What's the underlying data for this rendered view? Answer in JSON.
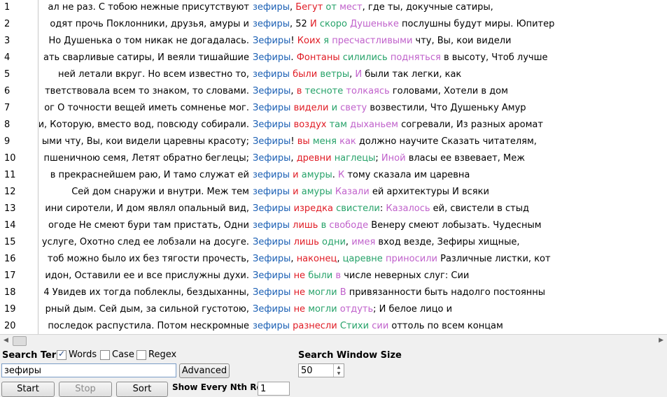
{
  "rows": [
    {
      "num": "1",
      "left": "ал не раз. С тобою нежные присутствуют",
      "right": [
        [
          "зефиры",
          "b"
        ],
        [
          ", ",
          "k"
        ],
        [
          "Бегут",
          "r"
        ],
        [
          " ",
          "k"
        ],
        [
          "от",
          "g"
        ],
        [
          " ",
          "k"
        ],
        [
          "мест",
          "m"
        ],
        [
          ", где ты, докучные сатиры,",
          "k"
        ]
      ]
    },
    {
      "num": "2",
      "left": "одят прочь Поклонники, друзья, амуры и",
      "right": [
        [
          "зефиры",
          "b"
        ],
        [
          ",  52 ",
          "k"
        ],
        [
          "И",
          "r"
        ],
        [
          " ",
          "k"
        ],
        [
          "скоро",
          "g"
        ],
        [
          " ",
          "k"
        ],
        [
          "Душеньке",
          "m"
        ],
        [
          " послушны будут миры. Юпитер",
          "k"
        ]
      ]
    },
    {
      "num": "3",
      "left": "Но Душенька о том никак не догадалась.",
      "right": [
        [
          "Зефиры",
          "b"
        ],
        [
          "! ",
          "k"
        ],
        [
          "Коих",
          "r"
        ],
        [
          " ",
          "k"
        ],
        [
          "я",
          "g"
        ],
        [
          " ",
          "k"
        ],
        [
          "пресчастливыми",
          "m"
        ],
        [
          " чту, Вы, кои видели",
          "k"
        ]
      ]
    },
    {
      "num": "4",
      "left": "ать сварливые сатиры, И веяли тишайшие",
      "right": [
        [
          "Зефиры",
          "b"
        ],
        [
          ". ",
          "k"
        ],
        [
          "Фонтаны",
          "r"
        ],
        [
          " ",
          "k"
        ],
        [
          "силились",
          "g"
        ],
        [
          " ",
          "k"
        ],
        [
          "подняться",
          "m"
        ],
        [
          " в высоту, Чтоб лучше",
          "k"
        ]
      ]
    },
    {
      "num": "5",
      "left": "ней летали вкруг. Но всем известно то,",
      "right": [
        [
          "зефиры",
          "b"
        ],
        [
          " ",
          "k"
        ],
        [
          "были",
          "r"
        ],
        [
          " ",
          "k"
        ],
        [
          "ветры",
          "g"
        ],
        [
          ", ",
          "k"
        ],
        [
          "И",
          "m"
        ],
        [
          " были так легки, как",
          "k"
        ]
      ]
    },
    {
      "num": "6",
      "left": "тветствовала всем то знаком, то словами.",
      "right": [
        [
          "Зефиры",
          "b"
        ],
        [
          ", ",
          "k"
        ],
        [
          "в",
          "r"
        ],
        [
          " ",
          "k"
        ],
        [
          "тесноте",
          "g"
        ],
        [
          " ",
          "k"
        ],
        [
          "толкаясь",
          "m"
        ],
        [
          " головами, Хотели в дом",
          "k"
        ]
      ]
    },
    {
      "num": "7",
      "left": "ог О точности вещей иметь сомненье мог.",
      "right": [
        [
          "Зефиры",
          "b"
        ],
        [
          " ",
          "k"
        ],
        [
          "видели",
          "r"
        ],
        [
          " ",
          "k"
        ],
        [
          "и",
          "g"
        ],
        [
          " ",
          "k"
        ],
        [
          "свету",
          "m"
        ],
        [
          " возвестили, Что Душеньку Амур",
          "k"
        ]
      ]
    },
    {
      "num": "8",
      "left": "и, Которую, вместо вод, повсюду собирали.",
      "right": [
        [
          "Зефиры",
          "b"
        ],
        [
          " ",
          "k"
        ],
        [
          "воздух",
          "r"
        ],
        [
          " ",
          "k"
        ],
        [
          "там",
          "g"
        ],
        [
          " ",
          "k"
        ],
        [
          "дыханьем",
          "m"
        ],
        [
          " согревали, Из разных аромат",
          "k"
        ]
      ]
    },
    {
      "num": "9",
      "left": "ыми чту, Вы, кои видели царевны красоту;",
      "right": [
        [
          "Зефиры",
          "b"
        ],
        [
          "! ",
          "k"
        ],
        [
          "вы",
          "r"
        ],
        [
          " ",
          "k"
        ],
        [
          "меня",
          "g"
        ],
        [
          " ",
          "k"
        ],
        [
          "как",
          "m"
        ],
        [
          " должно научите Сказать читателям,",
          "k"
        ]
      ]
    },
    {
      "num": "10",
      "left": "пшеничною семя, Летят обратно беглецы;",
      "right": [
        [
          "Зефиры",
          "b"
        ],
        [
          ", ",
          "k"
        ],
        [
          "древни",
          "r"
        ],
        [
          " ",
          "k"
        ],
        [
          "наглецы",
          "g"
        ],
        [
          "; ",
          "k"
        ],
        [
          "Иной",
          "m"
        ],
        [
          " власы ее взвевает, Меж",
          "k"
        ]
      ]
    },
    {
      "num": "11",
      "left": "в прекраснейшем раю, И тамо служат ей",
      "right": [
        [
          "зефиры",
          "b"
        ],
        [
          " ",
          "k"
        ],
        [
          "и",
          "r"
        ],
        [
          " ",
          "k"
        ],
        [
          "амуры",
          "g"
        ],
        [
          ". ",
          "k"
        ],
        [
          "К",
          "m"
        ],
        [
          " тому сказала им царевна",
          "k"
        ]
      ]
    },
    {
      "num": "12",
      "left": "Сей дом снаружи и внутри. Меж тем",
      "right": [
        [
          "зефиры",
          "b"
        ],
        [
          " ",
          "k"
        ],
        [
          "и",
          "r"
        ],
        [
          " ",
          "k"
        ],
        [
          "амуры",
          "g"
        ],
        [
          " ",
          "k"
        ],
        [
          "Казали",
          "m"
        ],
        [
          " ей архитектуры И всяки",
          "k"
        ]
      ]
    },
    {
      "num": "13",
      "left": "ини сиротели, И дом являл опальный вид,",
      "right": [
        [
          "Зефиры",
          "b"
        ],
        [
          " ",
          "k"
        ],
        [
          "изредка",
          "r"
        ],
        [
          " ",
          "k"
        ],
        [
          "свистели",
          "g"
        ],
        [
          ": ",
          "k"
        ],
        [
          "Казалось",
          "m"
        ],
        [
          " ей, свистели в стыд",
          "k"
        ]
      ]
    },
    {
      "num": "14",
      "left": "огоде Не смеют бури там пристать, Одни",
      "right": [
        [
          "зефиры",
          "b"
        ],
        [
          " ",
          "k"
        ],
        [
          "лишь",
          "r"
        ],
        [
          " ",
          "k"
        ],
        [
          "в",
          "g"
        ],
        [
          " ",
          "k"
        ],
        [
          "свободе",
          "m"
        ],
        [
          " Венеру смеют лобызать. Чудесным",
          "k"
        ]
      ]
    },
    {
      "num": "15",
      "left": "услуге, Охотно след ее лобзали на досуге.",
      "right": [
        [
          "Зефиры",
          "b"
        ],
        [
          " ",
          "k"
        ],
        [
          "лишь",
          "r"
        ],
        [
          " ",
          "k"
        ],
        [
          "одни",
          "g"
        ],
        [
          ", ",
          "k"
        ],
        [
          "имея",
          "m"
        ],
        [
          " вход везде, Зефиры хищные,",
          "k"
        ]
      ]
    },
    {
      "num": "16",
      "left": "тоб можно было их без тягости прочесть,",
      "right": [
        [
          "Зефиры",
          "b"
        ],
        [
          ", ",
          "k"
        ],
        [
          "наконец",
          "r"
        ],
        [
          ", ",
          "k"
        ],
        [
          "царевне",
          "g"
        ],
        [
          " ",
          "k"
        ],
        [
          "приносили",
          "m"
        ],
        [
          " Различные листки, кот",
          "k"
        ]
      ]
    },
    {
      "num": "17",
      "left": "идон, Оставили ее и все прислужны духи.",
      "right": [
        [
          "Зефиры",
          "b"
        ],
        [
          " ",
          "k"
        ],
        [
          "не",
          "r"
        ],
        [
          " ",
          "k"
        ],
        [
          "были",
          "g"
        ],
        [
          " ",
          "k"
        ],
        [
          "в",
          "m"
        ],
        [
          " числе неверных слуг: Сии",
          "k"
        ]
      ]
    },
    {
      "num": "18",
      "left": "4 Увидев их тогда поблеклы, бездыханны,",
      "right": [
        [
          "Зефиры",
          "b"
        ],
        [
          " ",
          "k"
        ],
        [
          "не",
          "r"
        ],
        [
          " ",
          "k"
        ],
        [
          "могли",
          "g"
        ],
        [
          " ",
          "k"
        ],
        [
          "В",
          "m"
        ],
        [
          " привязанности быть надолго постоянны",
          "k"
        ]
      ]
    },
    {
      "num": "19",
      "left": "рный дым. Сей дым, за сильной густотою,",
      "right": [
        [
          "Зефиры",
          "b"
        ],
        [
          " ",
          "k"
        ],
        [
          "не",
          "r"
        ],
        [
          " ",
          "k"
        ],
        [
          "могли",
          "g"
        ],
        [
          " ",
          "k"
        ],
        [
          "отдуть",
          "m"
        ],
        [
          "; И белое лицо и",
          "k"
        ]
      ]
    },
    {
      "num": "20",
      "left": "последок распустила. Потом нескромные",
      "right": [
        [
          "зефиры",
          "b"
        ],
        [
          " ",
          "k"
        ],
        [
          "разнесли",
          "r"
        ],
        [
          " ",
          "k"
        ],
        [
          "Стихи",
          "g"
        ],
        [
          " ",
          "k"
        ],
        [
          "сии",
          "m"
        ],
        [
          " оттоль по всем концам",
          "k"
        ]
      ]
    }
  ],
  "colors": {
    "b": "#1a5fb4",
    "r": "#e01b24",
    "g": "#26a269",
    "m": "#c061cb",
    "k": "#000000"
  },
  "search": {
    "term_label": "Search Term",
    "words_label": "Words",
    "case_label": "Case",
    "regex_label": "Regex",
    "query": "зефиры",
    "advanced_label": "Advanced",
    "window_label": "Search Window Size",
    "window_value": "50"
  },
  "bottom": {
    "start_label": "Start",
    "stop_label": "Stop",
    "sort_label": "Sort",
    "clusters_label": "Show Every Nth Row",
    "nth_value": "1"
  }
}
